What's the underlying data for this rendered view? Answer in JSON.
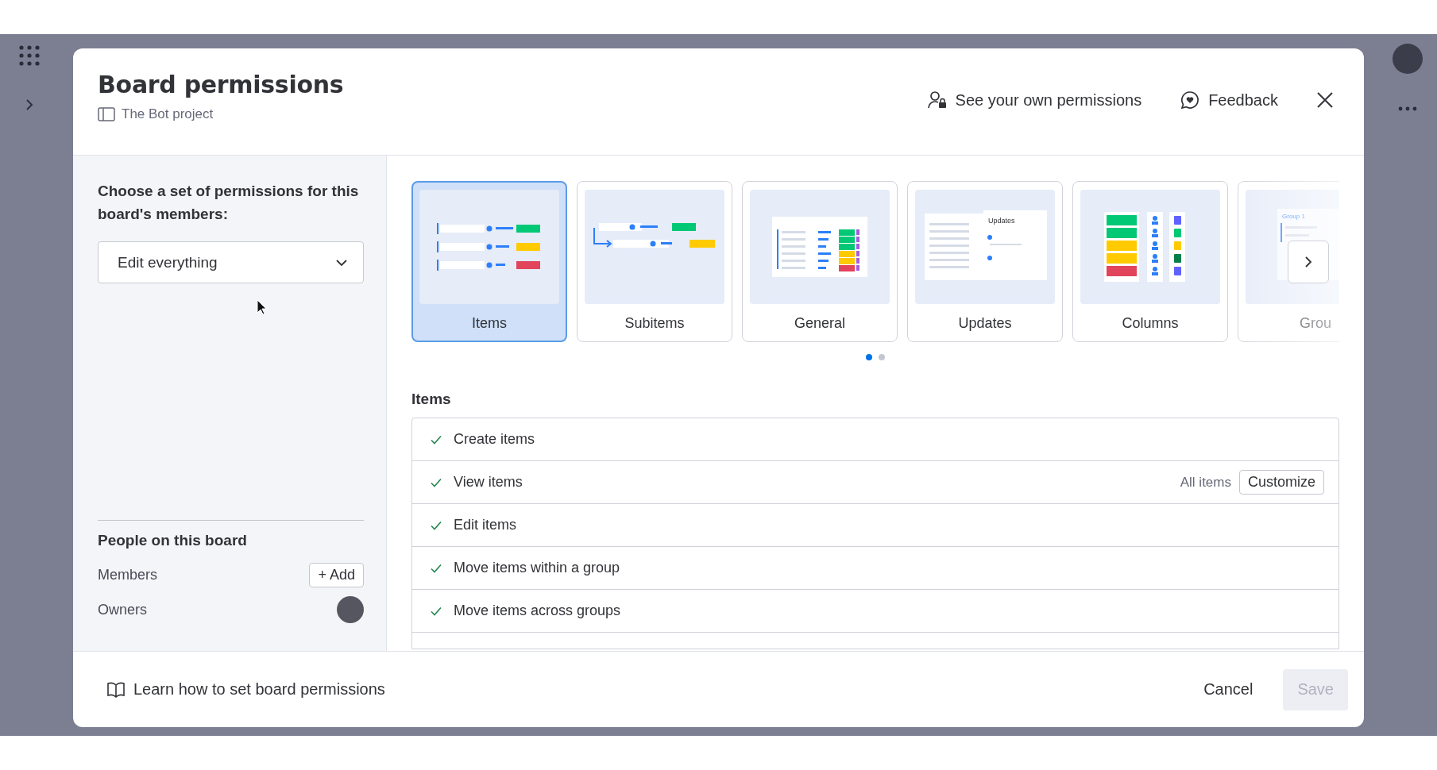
{
  "dialog": {
    "title": "Board permissions",
    "board": "The Bot project",
    "header_actions": [
      {
        "label": "See your own permissions",
        "kind": "permissions"
      },
      {
        "label": "Feedback",
        "kind": "feedback"
      }
    ]
  },
  "sidebar": {
    "prompt": "Choose a set of permissions for this board's members:",
    "select": {
      "value": "Edit everything"
    },
    "people": {
      "title": "People on this board",
      "rows": [
        {
          "label": "Members",
          "kind": "add",
          "action": "+ Add"
        },
        {
          "label": "Owners",
          "kind": "avatar"
        }
      ]
    }
  },
  "categories": [
    {
      "label": "Items",
      "kind": "items",
      "selected": true
    },
    {
      "label": "Subitems",
      "kind": "subitems",
      "selected": false
    },
    {
      "label": "General",
      "kind": "general",
      "selected": false
    },
    {
      "label": "Updates",
      "kind": "updates",
      "selected": false,
      "thumb_text": "Updates"
    },
    {
      "label": "Columns",
      "kind": "columns",
      "selected": false
    },
    {
      "label": "Grou",
      "kind": "groups",
      "selected": false,
      "thumb_text": "Group 1"
    }
  ],
  "pager": [
    {
      "selected": true
    },
    {
      "selected": false
    }
  ],
  "section": {
    "title": "Items",
    "permissions": [
      {
        "label": "Create items",
        "checked": true
      },
      {
        "label": "View items",
        "checked": true,
        "scope": "All items",
        "action": "Customize"
      },
      {
        "label": "Edit items",
        "checked": true
      },
      {
        "label": "Move items within a group",
        "checked": true
      },
      {
        "label": "Move items across groups",
        "checked": true
      }
    ]
  },
  "footer": {
    "help_link": "Learn how to set board permissions",
    "buttons": [
      {
        "label": "Cancel",
        "kind": "secondary",
        "disabled": false
      },
      {
        "label": "Save",
        "kind": "primary",
        "disabled": true
      }
    ]
  }
}
